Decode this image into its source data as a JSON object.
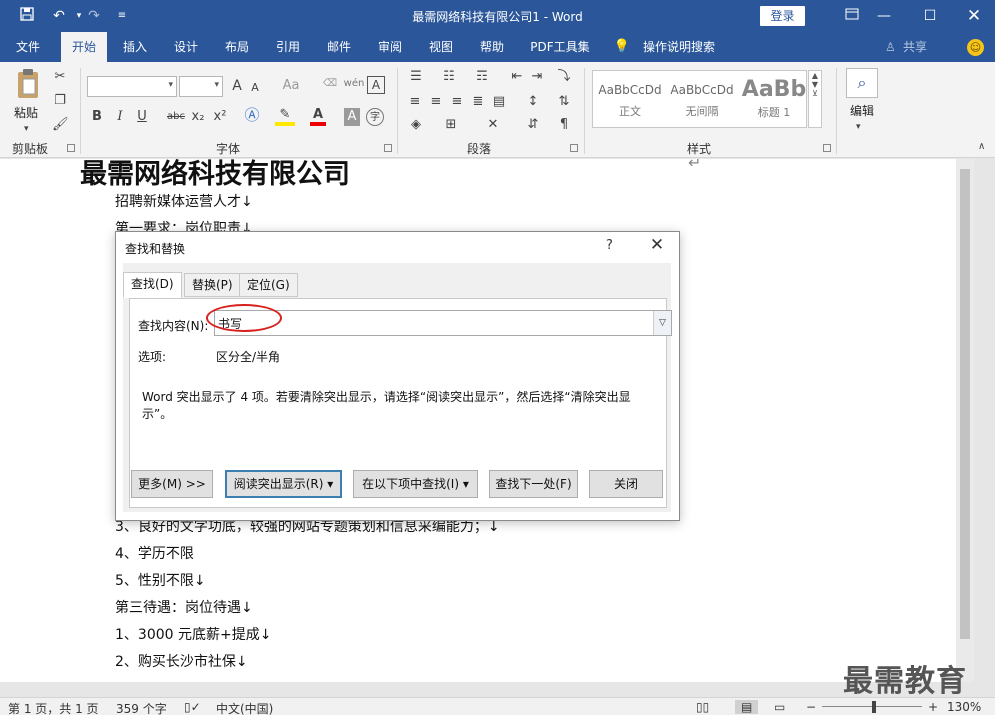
{
  "titlebar": {
    "title": "最需网络科技有限公司1  -  Word",
    "login": "登录",
    "icons": [
      "save-icon",
      "undo-icon",
      "redo-icon",
      "customize-icon"
    ],
    "window_buttons": [
      "ribbon-display-icon",
      "minimize-icon",
      "maximize-icon",
      "close-icon"
    ]
  },
  "ribbon_tabs": [
    "文件",
    "开始",
    "插入",
    "设计",
    "布局",
    "引用",
    "邮件",
    "审阅",
    "视图",
    "帮助",
    "PDF工具集"
  ],
  "active_tab": "开始",
  "tellme": "操作说明搜索",
  "share": "共享",
  "ribbon": {
    "paste_label": "粘贴",
    "groups": {
      "clipboard": "剪贴板",
      "font": "字体",
      "paragraph": "段落",
      "styles": "样式",
      "editing": "编辑"
    },
    "styles": [
      {
        "sample": "AaBbCcDd",
        "name": "正文"
      },
      {
        "sample": "AaBbCcDd",
        "name": "无间隔"
      },
      {
        "sample": "AaBb",
        "name": "标题 1"
      }
    ],
    "font_buttons": {
      "bold": "B",
      "italic": "I",
      "underline": "U",
      "strike": "abc",
      "sub": "x₂",
      "sup": "x²",
      "grow": "A",
      "shrink": "A",
      "case": "Aa",
      "phonetic": "wén",
      "charborder": "A",
      "shade": "A"
    }
  },
  "document": {
    "heading": "最需网络科技有限公司",
    "lines_top": [
      "招聘新媒体运营人才↓",
      "第一要求：岗位职责↓"
    ],
    "lines_bottom": [
      "3、良好的文字功底，较强的网站专题策划和信息采编能力；↓",
      "4、学历不限",
      "5、性别不限↓",
      "第三待遇：岗位待遇↓",
      "1、3000 元底薪+提成↓",
      "2、购买长沙市社保↓"
    ]
  },
  "dialog": {
    "title": "查找和替换",
    "help": "?",
    "tabs": [
      "查找(D)",
      "替换(P)",
      "定位(G)"
    ],
    "active_tab": "查找(D)",
    "find_label": "查找内容(N):",
    "find_value": "书写",
    "options_label": "选项:",
    "options_value": "区分全/半角",
    "message": "Word 突出显示了 4 项。若要清除突出显示，请选择“阅读突出显示”，然后选择“清除突出显示”。",
    "buttons": {
      "more": "更多(M) >>",
      "reading_highlight": "阅读突出显示(R) ▾",
      "find_in": "在以下项中查找(I) ▾",
      "find_next": "查找下一处(F)",
      "close": "关闭"
    },
    "highlight_color": "#d8201c"
  },
  "statusbar": {
    "page": "第 1 页，共 1 页",
    "words": "359 个字",
    "language": "中文(中国)",
    "zoom": "130%"
  },
  "watermark": "最需教育",
  "colors": {
    "brand": "#2b579a",
    "ribbon_bg": "#f3f3f3"
  }
}
